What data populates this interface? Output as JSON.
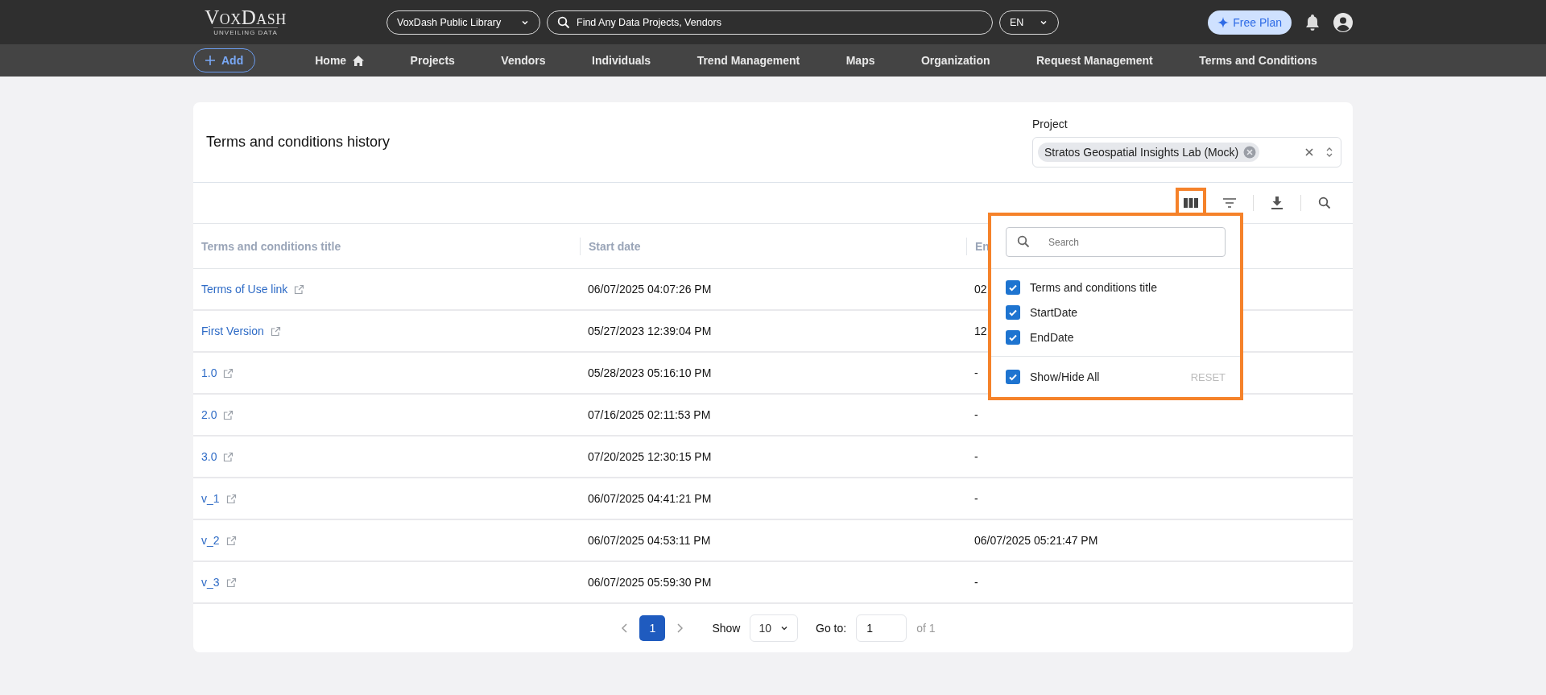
{
  "header": {
    "logo": "VoxDash",
    "tagline": "UNVEILING DATA",
    "library": "VoxDash Public Library",
    "search_placeholder": "Find Any Data Projects, Vendors",
    "language": "EN",
    "plan_button": "Free Plan"
  },
  "nav": {
    "add_button": "Add",
    "items": [
      {
        "label": "Home",
        "kind": "home"
      },
      {
        "label": "Projects",
        "kind": "plain"
      },
      {
        "label": "Vendors",
        "kind": "plain"
      },
      {
        "label": "Individuals",
        "kind": "plain"
      },
      {
        "label": "Trend Management",
        "kind": "plain"
      },
      {
        "label": "Maps",
        "kind": "plain"
      },
      {
        "label": "Organization",
        "kind": "plain"
      },
      {
        "label": "Request Management",
        "kind": "plain"
      },
      {
        "label": "Terms and Conditions",
        "kind": "plain"
      }
    ]
  },
  "card": {
    "title": "Terms and conditions history",
    "project_label": "Project",
    "project_chip": "Stratos Geospatial Insights Lab (Mock)"
  },
  "table": {
    "columns": [
      "Terms and conditions title",
      "Start date",
      "En"
    ],
    "rows": [
      {
        "title": "Terms of Use link",
        "start": "06/07/2025 04:07:26 PM",
        "end": "02"
      },
      {
        "title": "First Version",
        "start": "05/27/2023 12:39:04 PM",
        "end": "12"
      },
      {
        "title": "1.0",
        "start": "05/28/2023 05:16:10 PM",
        "end": "-"
      },
      {
        "title": "2.0",
        "start": "07/16/2025 02:11:53 PM",
        "end": "-"
      },
      {
        "title": "3.0",
        "start": "07/20/2025 12:30:15 PM",
        "end": "-"
      },
      {
        "title": "v_1",
        "start": "06/07/2025 04:41:21 PM",
        "end": "-"
      },
      {
        "title": "v_2",
        "start": "06/07/2025 04:53:11 PM",
        "end": "06/07/2025 05:21:47 PM"
      },
      {
        "title": "v_3",
        "start": "06/07/2025 05:59:30 PM",
        "end": "-"
      }
    ]
  },
  "column_menu": {
    "search_placeholder": "Search",
    "options": [
      {
        "label": "Terms and conditions title",
        "checked": true
      },
      {
        "label": "StartDate",
        "checked": true
      },
      {
        "label": "EndDate",
        "checked": true
      }
    ],
    "show_all": {
      "label": "Show/Hide All",
      "checked": true
    },
    "reset": "RESET"
  },
  "pagination": {
    "pages": [
      {
        "label": "1",
        "selected": true
      }
    ],
    "show_label": "Show",
    "page_size": "10",
    "goto_label": "Go to:",
    "goto_value": "1",
    "total": "of 1"
  }
}
